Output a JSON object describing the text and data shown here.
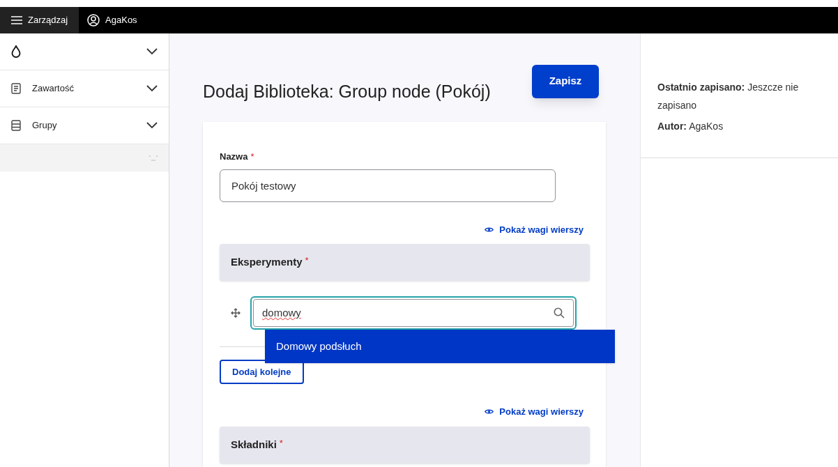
{
  "toolbar": {
    "menu_label": "Zarządzaj",
    "user_label": "AgaKos"
  },
  "sidebar": {
    "items": [
      {
        "kind": "logo",
        "expanded": false
      },
      {
        "kind": "content",
        "label": "Zawartość",
        "expanded": false
      },
      {
        "kind": "groups",
        "label": "Grupy",
        "expanded": false
      }
    ]
  },
  "page": {
    "title": "Dodaj Biblioteka: Group node (Pokój)",
    "save_button": "Zapisz"
  },
  "form": {
    "name_label": "Nazwa",
    "required_mark": "*",
    "name_value": "Pokój testowy",
    "fields": [
      {
        "weights_link": "Pokaż wagi wierszy",
        "heading": "Eksperymenty",
        "search_value": "domowy",
        "suggestions": [
          {
            "label": "Domowy podsłuch",
            "selected": true
          }
        ],
        "add_button": "Dodaj kolejne"
      },
      {
        "weights_link": "Pokaż wagi wierszy",
        "heading": "Składniki"
      }
    ]
  },
  "meta": {
    "last_saved_label": "Ostatnio zapisano:",
    "last_saved_value": "Jeszcze nie zapisano",
    "author_label": "Autor:",
    "author_value": "AgaKos"
  }
}
